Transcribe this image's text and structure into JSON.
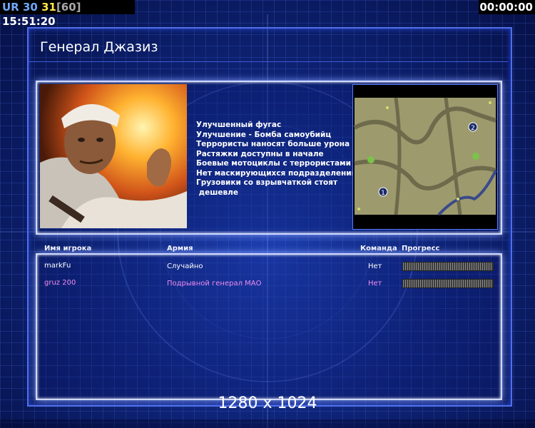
{
  "hud": {
    "prefix": "UR",
    "count_a": "30",
    "count_b": "31",
    "bracket": "[60]",
    "clock": "15:51:20",
    "timer": "00:00:00"
  },
  "general": {
    "title": "Генерал Джазиз",
    "traits": [
      "Улучшенный фугас",
      "Улучшение - Бомба самоубийц",
      "Террористы наносят больше урона",
      "Растяжки доступны в начале",
      "Боевые мотоциклы с террористами",
      "Нет маскирующихся подразделений",
      "Грузовики со взрывчаткой стоят",
      " дешевле"
    ]
  },
  "minimap": {
    "start_positions": [
      "1",
      "2"
    ]
  },
  "players_table": {
    "headers": {
      "name": "Имя игрока",
      "army": "Армия",
      "team": "Команда",
      "progress": "Прогресс"
    },
    "rows": [
      {
        "name": "markFu",
        "army": "Случайно",
        "team": "Нет",
        "color": "#ffffff",
        "progress": 1.0
      },
      {
        "name": "gruz 200",
        "army": "Подрывной генерал МАО",
        "team": "Нет",
        "color": "#f08cf0",
        "progress": 1.0
      }
    ]
  },
  "resolution_label": "1280 x 1024",
  "colors": {
    "accent": "#4f6fe8",
    "hud_blue": "#6fa8ff",
    "hud_yellow": "#ffe94a",
    "player2": "#f08cf0"
  }
}
